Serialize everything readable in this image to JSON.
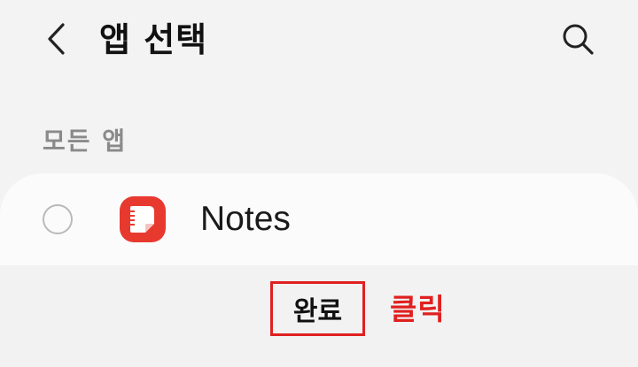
{
  "header": {
    "back_icon": "chevron-left-icon",
    "title": "앱 선택",
    "search_icon": "search-icon"
  },
  "section": {
    "label": "모든 앱"
  },
  "apps": [
    {
      "name": "Notes",
      "selected": false,
      "icon": "notes-app-icon"
    }
  ],
  "footer": {
    "done_label": "완료"
  },
  "annotation": {
    "text": "클릭",
    "color": "#e02020"
  },
  "colors": {
    "background": "#f3f3f3",
    "card": "#fbfbfb",
    "accent_red": "#e02020",
    "notes_icon": "#e8392f"
  }
}
